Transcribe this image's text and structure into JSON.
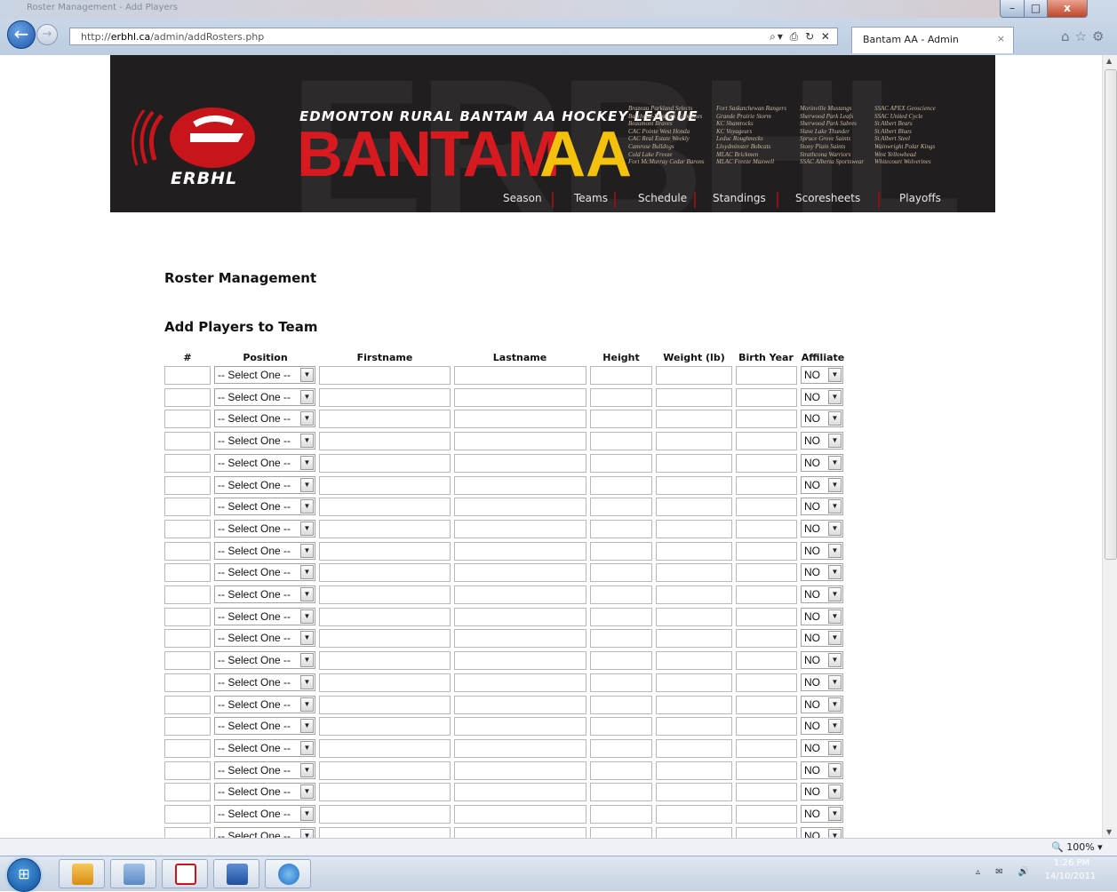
{
  "window": {
    "title_bar_text": "Roster Management - Add Players",
    "minimize_glyph": "–",
    "maximize_glyph": "□",
    "close_glyph": "x"
  },
  "browser": {
    "url_prefix": "http://",
    "url_host": "erbhl.ca",
    "url_path": "/admin/addRosters.php",
    "address_tools": "⌕▾ ⎙ ↻ ✕",
    "tab_title": "Bantam AA - Admin",
    "tab_close": "×",
    "back_glyph": "←",
    "forward_glyph": "→",
    "toolbar_icons": "⌂☆⚙"
  },
  "banner": {
    "logo_text": "ERBHL",
    "league_name": "EDMONTON RURAL BANTAM AA HOCKEY LEAGUE",
    "bantam": "BANTAM",
    "aa": "AA",
    "watermark": "ERBHL",
    "team_columns": [
      [
        "Brazeau Parkland Selects",
        "Barrhead-Westlock Combines",
        "Beaumont Braves",
        "CAC Pointe West Honda",
        "CAC Real Estate Weekly",
        "Camrose Bulldogs",
        "Cold Lake Freeze",
        "Fort McMurray Cedar Barons"
      ],
      [
        "Fort Saskatchewan Rangers",
        "Grande Prairie Storm",
        "KC Shamrocks",
        "KC Voyageurs",
        "Leduc Roughnecks",
        "Lloydminster Bobcats",
        "MLAC Brickmen",
        "MLAC Freeze Maxwell"
      ],
      [
        "Morinville Mustangs",
        "Sherwood Park Leafs",
        "Sherwood Park Sabres",
        "Slave Lake Thunder",
        "Spruce Grove Saints",
        "Stony Plain Saints",
        "Strathcona Warriors",
        "SSAC Alberta Sportswear"
      ],
      [
        "SSAC APEX Geoscience",
        "SSAC United Cycle",
        "St Albert Bears",
        "St Albert Blues",
        "St Albert Steel",
        "Wainwright Polar Kings",
        "West Yellowhead",
        "Whitecourt Wolverines"
      ]
    ],
    "nav": [
      "Season",
      "Teams",
      "Schedule",
      "Standings",
      "Scoresheets",
      "Playoffs"
    ]
  },
  "content": {
    "page_title": "Roster Management",
    "section_title": "Add Players to Team",
    "columns": [
      "#",
      "Position",
      "Firstname",
      "Lastname",
      "Height",
      "Weight (lb)",
      "Birth Year",
      "Affiliate"
    ],
    "position_default": "-- Select One --",
    "affiliate_default": "NO",
    "row_count": 22
  },
  "statusbar": {
    "zoom": "100%",
    "zoom_icon": "🔍"
  },
  "taskbar": {
    "start_glyph": "⊞",
    "tray": "▵ ✉ 🔊",
    "time": "1:26 PM",
    "date": "14/10/2011"
  }
}
